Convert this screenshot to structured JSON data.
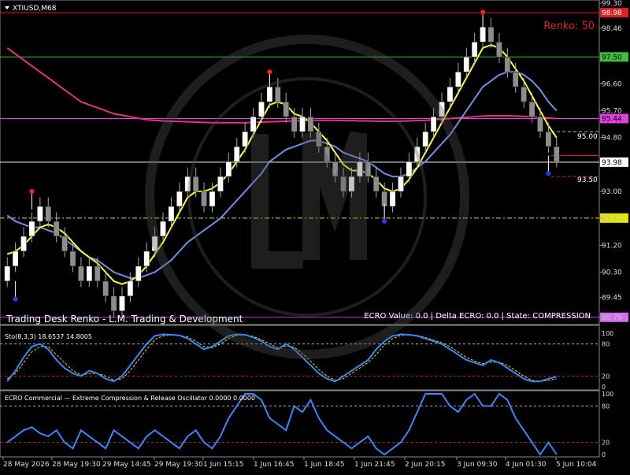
{
  "window": {
    "symbol_label": "XTIUSD,M68",
    "renko_label": "Renko: 50",
    "indicator_title": "Trading Desk Renko - L.M. Trading & Development",
    "ecro_status": "ECRO Value: 0.0  |  Delta ECRO: 0.0  |  State: COMPRESSION"
  },
  "colors": {
    "background": "#000000",
    "bull_brick": "#ffffff",
    "bear_brick": "#8c8c8c",
    "ma_fast": "#ffff33",
    "ma_slow": "#6f8fe6",
    "ma_long": "#e0357a",
    "level_red": "#e02020",
    "level_green": "#3fbf3f",
    "level_magenta": "#e040e0",
    "level_yellow": "#e6e600",
    "osc_line": "#3a86ff"
  },
  "price_axis": {
    "min": 88.6,
    "max": 99.3,
    "ticks": [
      "99.30",
      "98.46",
      "96.60",
      "95.70",
      "94.80",
      "93.00",
      "92.11",
      "91.20",
      "90.30",
      "89.45",
      "88.79"
    ]
  },
  "price_levels": [
    {
      "value": 98.98,
      "label": "98.98",
      "style": "red"
    },
    {
      "value": 97.5,
      "label": "97.50",
      "style": "green"
    },
    {
      "value": 95.44,
      "label": "95.44",
      "style": "magenta"
    },
    {
      "value": 93.98,
      "label": "93.98",
      "style": "white"
    },
    {
      "value": 92.11,
      "label": "92.11",
      "style": "yellow"
    },
    {
      "value": 88.79,
      "label": "88.79",
      "style": "purple"
    }
  ],
  "annotations": {
    "label_95": "95.00",
    "label_935": "93.50"
  },
  "time_axis": [
    "28 May 2026",
    "28 May 19:30",
    "29 May 14:45",
    "29 May 19:30",
    "1 Jun 15:15",
    "1 Jun 16:45",
    "1 Jun 18:45",
    "1 Jun 21:45",
    "2 Jun 20:15",
    "3 Jun 09:30",
    "4 Jun 01:30",
    "5 Jun 10:04"
  ],
  "stochastic": {
    "label": "Sto(8,3,3) 18.6537 14.8005",
    "levels": [
      "100",
      "80",
      "20",
      "0"
    ]
  },
  "ecro": {
    "label": "ECRO Commercial — Extreme Compression & Release Oscillator 0.0000 0.0000",
    "levels": [
      "100",
      "80",
      "20",
      "0"
    ]
  },
  "chart_data": {
    "type": "renko",
    "brick_size": 0.5,
    "closes": [
      90.5,
      91.0,
      91.5,
      92.0,
      92.5,
      92.0,
      91.5,
      91.0,
      90.5,
      90.0,
      90.5,
      90.0,
      89.5,
      89.0,
      89.5,
      90.0,
      90.5,
      91.0,
      91.5,
      92.0,
      92.5,
      93.0,
      93.5,
      93.0,
      92.5,
      93.0,
      93.5,
      94.0,
      94.5,
      95.0,
      95.5,
      96.0,
      96.5,
      96.0,
      95.5,
      95.0,
      95.5,
      95.0,
      94.5,
      94.0,
      93.5,
      93.0,
      93.5,
      94.0,
      93.5,
      93.0,
      92.5,
      93.0,
      93.5,
      94.0,
      94.5,
      95.0,
      95.5,
      96.0,
      96.5,
      97.0,
      97.5,
      98.0,
      98.5,
      98.0,
      97.5,
      97.0,
      96.5,
      96.0,
      95.5,
      95.0,
      94.5,
      94.0
    ],
    "ma_fast": [
      90.9,
      91.0,
      91.2,
      91.5,
      91.8,
      91.9,
      91.8,
      91.6,
      91.3,
      91.0,
      90.8,
      90.6,
      90.3,
      90.0,
      89.9,
      90.0,
      90.2,
      90.5,
      90.9,
      91.3,
      91.8,
      92.3,
      92.8,
      93.0,
      93.0,
      93.1,
      93.3,
      93.6,
      94.0,
      94.4,
      94.9,
      95.4,
      95.9,
      96.0,
      95.9,
      95.6,
      95.5,
      95.3,
      95.0,
      94.7,
      94.3,
      93.9,
      93.7,
      93.7,
      93.6,
      93.4,
      93.1,
      93.0,
      93.1,
      93.4,
      93.8,
      94.3,
      94.8,
      95.3,
      95.8,
      96.3,
      96.8,
      97.3,
      97.8,
      97.9,
      97.8,
      97.5,
      97.1,
      96.7,
      96.2,
      95.7,
      95.2,
      94.8
    ],
    "ma_slow": [
      92.2,
      92.0,
      91.9,
      91.8,
      91.8,
      91.7,
      91.6,
      91.4,
      91.2,
      91.0,
      90.8,
      90.7,
      90.5,
      90.3,
      90.2,
      90.1,
      90.1,
      90.2,
      90.3,
      90.5,
      90.7,
      91.0,
      91.3,
      91.5,
      91.7,
      91.9,
      92.1,
      92.4,
      92.7,
      93.0,
      93.3,
      93.6,
      94.0,
      94.2,
      94.4,
      94.5,
      94.6,
      94.7,
      94.7,
      94.6,
      94.5,
      94.3,
      94.2,
      94.1,
      94.0,
      93.8,
      93.6,
      93.5,
      93.5,
      93.6,
      93.8,
      94.0,
      94.3,
      94.6,
      94.9,
      95.3,
      95.7,
      96.1,
      96.5,
      96.7,
      96.9,
      97.0,
      97.0,
      96.9,
      96.7,
      96.4,
      96.0,
      95.7
    ],
    "ma_long": [
      97.8,
      97.6,
      97.4,
      97.2,
      97.0,
      96.8,
      96.6,
      96.4,
      96.2,
      96.0,
      95.9,
      95.8,
      95.7,
      95.6,
      95.55,
      95.5,
      95.45,
      95.4,
      95.38,
      95.36,
      95.35,
      95.34,
      95.33,
      95.32,
      95.31,
      95.3,
      95.3,
      95.3,
      95.3,
      95.3,
      95.31,
      95.32,
      95.33,
      95.34,
      95.35,
      95.36,
      95.37,
      95.38,
      95.38,
      95.38,
      95.38,
      95.37,
      95.37,
      95.36,
      95.36,
      95.35,
      95.35,
      95.35,
      95.35,
      95.36,
      95.37,
      95.38,
      95.4,
      95.42,
      95.44,
      95.46,
      95.48,
      95.5,
      95.52,
      95.53,
      95.53,
      95.53,
      95.52,
      95.51,
      95.5,
      95.48,
      95.46,
      95.44
    ],
    "stoch_k": [
      10,
      30,
      55,
      75,
      80,
      70,
      50,
      35,
      25,
      20,
      30,
      25,
      15,
      10,
      20,
      40,
      60,
      80,
      95,
      98,
      97,
      96,
      90,
      80,
      70,
      75,
      85,
      95,
      98,
      97,
      92,
      85,
      75,
      70,
      80,
      70,
      55,
      40,
      25,
      15,
      10,
      20,
      30,
      40,
      50,
      70,
      85,
      95,
      98,
      97,
      95,
      90,
      85,
      80,
      70,
      60,
      50,
      45,
      40,
      50,
      45,
      35,
      25,
      15,
      10,
      10,
      15,
      18.65
    ],
    "stoch_d": [
      15,
      25,
      45,
      65,
      75,
      75,
      60,
      45,
      30,
      22,
      25,
      25,
      20,
      12,
      15,
      30,
      50,
      70,
      88,
      95,
      97,
      96,
      93,
      85,
      75,
      73,
      80,
      90,
      96,
      97,
      94,
      88,
      80,
      73,
      76,
      74,
      62,
      48,
      32,
      20,
      12,
      15,
      25,
      35,
      45,
      60,
      78,
      90,
      96,
      97,
      96,
      92,
      87,
      82,
      75,
      65,
      55,
      48,
      43,
      46,
      46,
      40,
      30,
      20,
      12,
      10,
      12,
      14.8
    ],
    "ecro": [
      20,
      30,
      40,
      45,
      35,
      30,
      40,
      20,
      10,
      40,
      30,
      20,
      10,
      40,
      30,
      20,
      10,
      30,
      40,
      30,
      20,
      10,
      30,
      40,
      20,
      10,
      30,
      60,
      80,
      100,
      100,
      90,
      60,
      50,
      40,
      80,
      70,
      90,
      60,
      40,
      30,
      20,
      10,
      20,
      30,
      10,
      0,
      10,
      20,
      40,
      70,
      100,
      100,
      100,
      80,
      70,
      90,
      100,
      80,
      80,
      100,
      90,
      60,
      40,
      20,
      0,
      20,
      0
    ],
    "marks_top": [
      {
        "i": 3,
        "v": 93.0
      },
      {
        "i": 32,
        "v": 97.0
      },
      {
        "i": 58,
        "v": 99.0
      }
    ],
    "marks_bottom": [
      {
        "i": 1,
        "v": 89.4
      },
      {
        "i": 46,
        "v": 92.0
      },
      {
        "i": 66,
        "v": 93.6
      }
    ]
  }
}
